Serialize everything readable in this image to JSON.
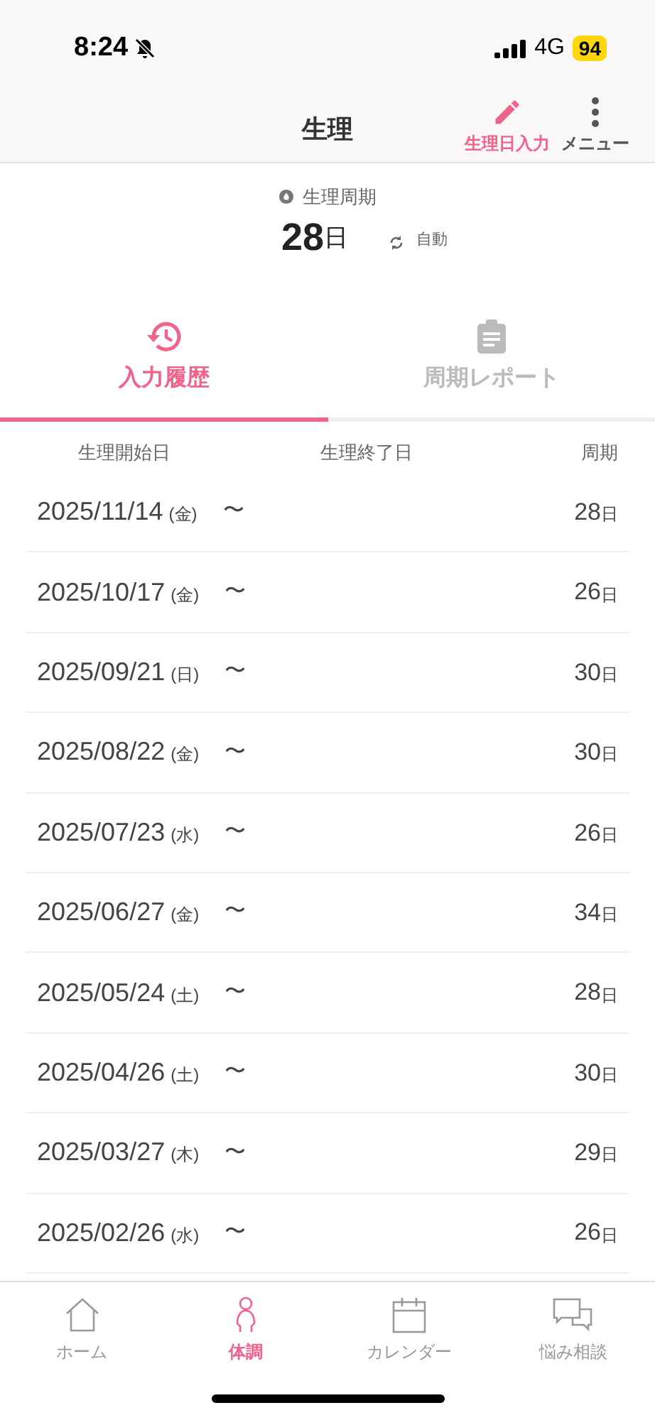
{
  "status_bar": {
    "time": "8:24",
    "network": "4G",
    "battery": "94"
  },
  "header": {
    "title": "生理",
    "actions": [
      {
        "kind": "pencil",
        "label": "生理日入力",
        "accent": true
      },
      {
        "kind": "dots",
        "label": "メニュー",
        "accent": false
      }
    ]
  },
  "summary": {
    "label": "生理周期",
    "value": "28",
    "unit": "日",
    "mode": "自動"
  },
  "tabs": [
    {
      "kind": "history",
      "label": "入力履歴",
      "selected": true
    },
    {
      "kind": "report",
      "label": "周期レポート",
      "selected": false
    }
  ],
  "table": {
    "columns": [
      "生理開始日",
      "生理終了日",
      "周期"
    ],
    "rows": [
      {
        "start": "2025/11/14",
        "weekday": "(金)",
        "sep": "〜",
        "cycle": "28",
        "unit": "日"
      },
      {
        "start": "2025/10/17",
        "weekday": "(金)",
        "sep": "〜",
        "cycle": "26",
        "unit": "日"
      },
      {
        "start": "2025/09/21",
        "weekday": "(日)",
        "sep": "〜",
        "cycle": "30",
        "unit": "日"
      },
      {
        "start": "2025/08/22",
        "weekday": "(金)",
        "sep": "〜",
        "cycle": "30",
        "unit": "日"
      },
      {
        "start": "2025/07/23",
        "weekday": "(水)",
        "sep": "〜",
        "cycle": "26",
        "unit": "日"
      },
      {
        "start": "2025/06/27",
        "weekday": "(金)",
        "sep": "〜",
        "cycle": "34",
        "unit": "日"
      },
      {
        "start": "2025/05/24",
        "weekday": "(土)",
        "sep": "〜",
        "cycle": "28",
        "unit": "日"
      },
      {
        "start": "2025/04/26",
        "weekday": "(土)",
        "sep": "〜",
        "cycle": "30",
        "unit": "日"
      },
      {
        "start": "2025/03/27",
        "weekday": "(木)",
        "sep": "〜",
        "cycle": "29",
        "unit": "日"
      },
      {
        "start": "2025/02/26",
        "weekday": "(水)",
        "sep": "〜",
        "cycle": "26",
        "unit": "日"
      }
    ]
  },
  "bottom_nav": [
    {
      "kind": "home",
      "label": "ホーム",
      "selected": false
    },
    {
      "kind": "body",
      "label": "体調",
      "selected": true
    },
    {
      "kind": "calendar",
      "label": "カレンダー",
      "selected": false
    },
    {
      "kind": "chat",
      "label": "悩み相談",
      "selected": false
    }
  ]
}
